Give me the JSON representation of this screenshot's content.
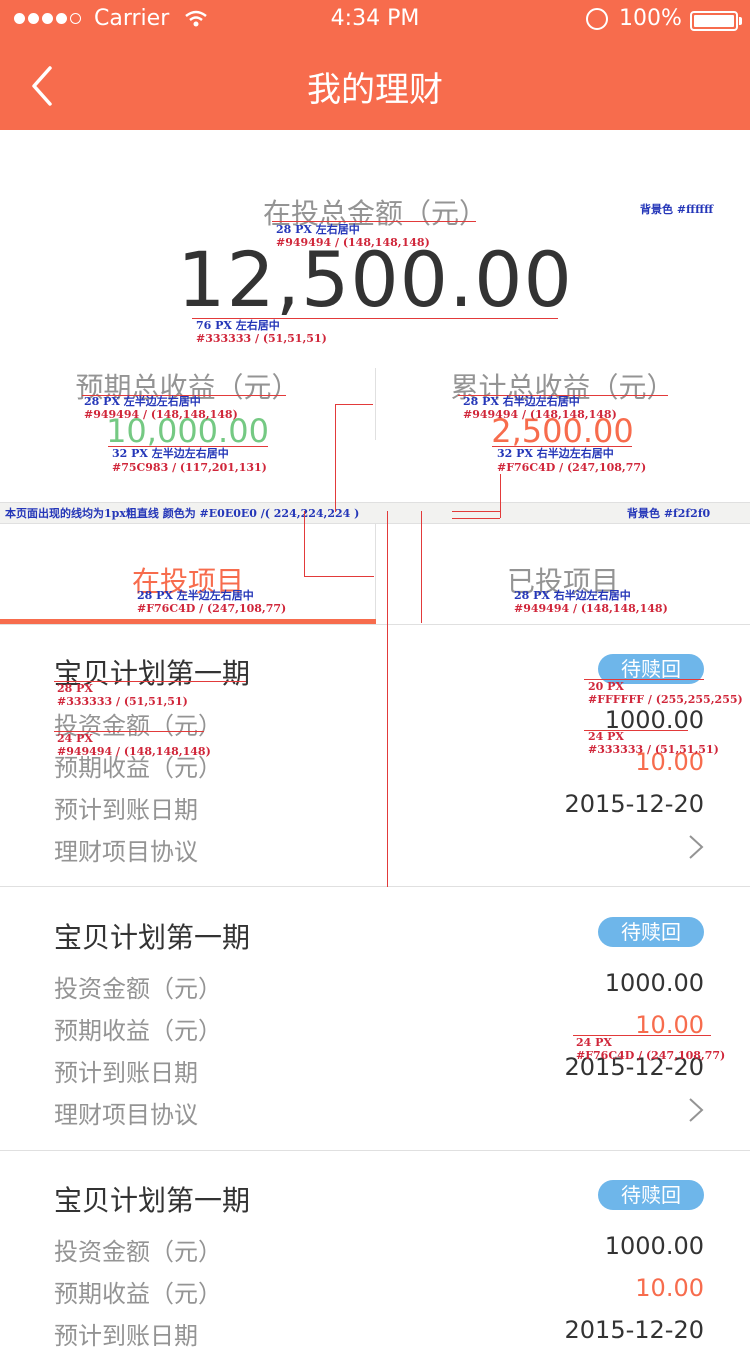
{
  "status_bar": {
    "carrier": "Carrier",
    "time": "4:34 PM",
    "battery": "100%"
  },
  "nav": {
    "title": "我的理财"
  },
  "summary": {
    "total_label": "在投总金额（元）",
    "total_value": "12,500.00",
    "expected_label": "预期总收益（元）",
    "expected_value": "10,000.00",
    "cumulative_label": "累计总收益（元）",
    "cumulative_value": "2,500.00"
  },
  "tabs": [
    {
      "label": "在投项目",
      "active": true
    },
    {
      "label": "已投项目",
      "active": false
    }
  ],
  "projects": [
    {
      "title": "宝贝计划第一期",
      "badge": "待赎回",
      "amount_label": "投资金额（元）",
      "amount": "1000.00",
      "income_label": "预期收益（元）",
      "income": "10.00",
      "date_label": "预计到账日期",
      "date": "2015-12-20",
      "agreement_label": "理财项目协议"
    },
    {
      "title": "宝贝计划第一期",
      "badge": "待赎回",
      "amount_label": "投资金额（元）",
      "amount": "1000.00",
      "income_label": "预期收益（元）",
      "income": "10.00",
      "date_label": "预计到账日期",
      "date": "2015-12-20",
      "agreement_label": "理财项目协议"
    },
    {
      "title": "宝贝计划第一期",
      "badge": "待赎回",
      "amount_label": "投资金额（元）",
      "amount": "1000.00",
      "income_label": "预期收益（元）",
      "income": "10.00",
      "date_label": "预计到账日期",
      "date": "2015-12-20"
    }
  ],
  "colors": {
    "accent": "#f76c4d",
    "green": "#75c983",
    "gray": "#949494",
    "dark": "#333333",
    "divider": "#e0e0e0",
    "band": "#f2f2f0",
    "badge": "#6eb6ea"
  },
  "annotations": {
    "bg_white": "背景色 #ffffff",
    "bg_gray": "背景色 #f2f2f0",
    "line_note": "本页面出现的线均为1px粗直线  颜色为 #E0E0E0 /( 224,224,224 )",
    "total_label_size": "28 PX 左右居中",
    "total_label_color": "#949494 / (148,148,148)",
    "total_value_size": "76 PX 左右居中",
    "total_value_color": "#333333 / (51,51,51)",
    "expected_label_size": "28 PX  左半边左右居中",
    "expected_label_color": "#949494 / (148,148,148)",
    "expected_value_size": "32 PX 左半边左右居中",
    "expected_value_color": "#75C983 / (117,201,131)",
    "cumulative_label_size": "28 PX  右半边左右居中",
    "cumulative_label_color": "#949494 / (148,148,148)",
    "cumulative_value_size": "32 PX 右半边左右居中",
    "cumulative_value_color": "#F76C4D / (247,108,77)",
    "tab_active_size": "28 PX 左半边左右居中",
    "tab_active_color": "#F76C4D / (247,108,77)",
    "tab_inactive_size": "28 PX 右半边左右居中",
    "tab_inactive_color": "#949494 / (148,148,148)",
    "title_size": "28 PX",
    "title_color": "#333333 / (51,51,51)",
    "label_size": "24 PX",
    "label_color": "#949494 / (148,148,148)",
    "badge_size": "20 PX",
    "badge_color": "#FFFFFF / (255,255,255)",
    "value_size": "24 PX",
    "value_color": "#333333 / (51,51,51)",
    "income_size": "24 PX",
    "income_color": "#F76C4D / (247,108,77)"
  }
}
